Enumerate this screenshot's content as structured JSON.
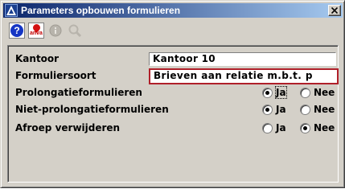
{
  "window": {
    "title": "Parameters opbouwen formulieren"
  },
  "toolbar": {
    "icons": [
      "help-icon",
      "anva-icon",
      "info-icon",
      "search-icon"
    ],
    "anva_label": "anva",
    "help_label": "?"
  },
  "form": {
    "kantoor": {
      "label": "Kantoor",
      "value": "Kantoor 10"
    },
    "formuliersoort": {
      "label": "Formuliersoort",
      "value": "Brieven aan relatie m.b.t. p"
    },
    "prolongatie": {
      "label": "Prolongatieformulieren",
      "yes_label": "Ja",
      "no_label": "Nee",
      "selected": "Ja"
    },
    "niet_prolongatie": {
      "label": "Niet-prolongatieformulieren",
      "yes_label": "Ja",
      "no_label": "Nee",
      "selected": "Ja"
    },
    "afroep": {
      "label": "Afroep verwijderen",
      "yes_label": "Ja",
      "no_label": "Nee",
      "selected": "Nee"
    }
  },
  "colors": {
    "title_gradient_start": "#0a246a",
    "title_gradient_end": "#a6caf0",
    "window_face": "#d4d0c8",
    "focus_border": "#b0202a"
  }
}
